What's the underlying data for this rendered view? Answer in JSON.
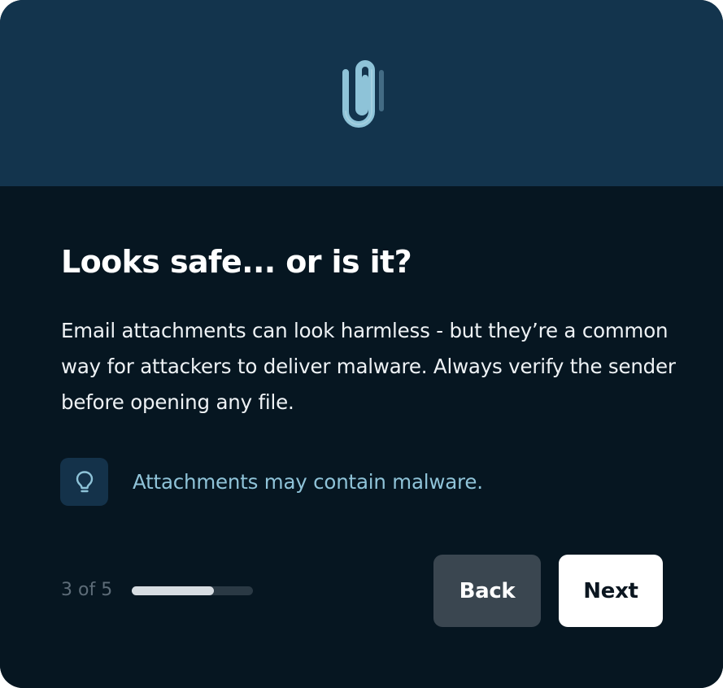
{
  "hero": {
    "icon": "paperclip-icon",
    "background_color": "#13344d",
    "icon_color": "#8ec3d8"
  },
  "card": {
    "title": "Looks safe... or is it?",
    "body": "Email attachments can look harmless - but they’re a common way for attackers to deliver malware. Always verify the sender before opening any file.",
    "background_color": "#061621"
  },
  "tip": {
    "icon": "lightbulb-icon",
    "text": "Attachments may contain malware.",
    "text_color": "#8fc3d8"
  },
  "progress": {
    "label": "3 of 5",
    "current": 3,
    "total": 5,
    "fill_fraction": 0.68
  },
  "buttons": {
    "back_label": "Back",
    "next_label": "Next"
  }
}
